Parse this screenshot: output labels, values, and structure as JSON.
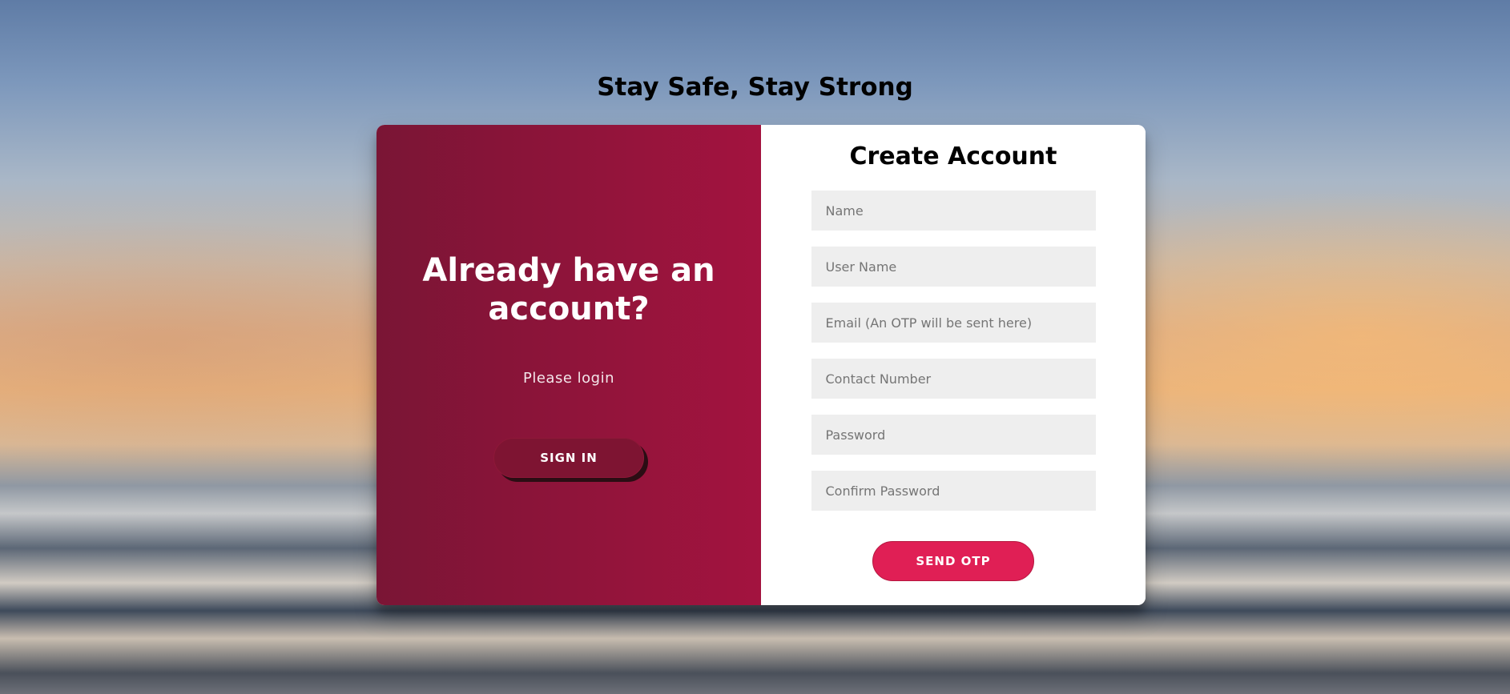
{
  "page": {
    "title": "Stay Safe, Stay Strong"
  },
  "overlay": {
    "heading": "Already have an account?",
    "text": "Please login",
    "sign_in_label": "SIGN IN"
  },
  "form": {
    "title": "Create Account",
    "fields": [
      {
        "placeholder": "Name",
        "value": ""
      },
      {
        "placeholder": "User Name",
        "value": ""
      },
      {
        "placeholder": "Email (An OTP will be sent here)",
        "value": ""
      },
      {
        "placeholder": "Contact Number",
        "value": ""
      },
      {
        "placeholder": "Password",
        "value": ""
      },
      {
        "placeholder": "Confirm Password",
        "value": ""
      }
    ],
    "submit_label": "SEND OTP"
  },
  "colors": {
    "overlay_start": "#7a1535",
    "overlay_end": "#a3133f",
    "primary": "#e01f55",
    "field_bg": "#eeeeee"
  }
}
